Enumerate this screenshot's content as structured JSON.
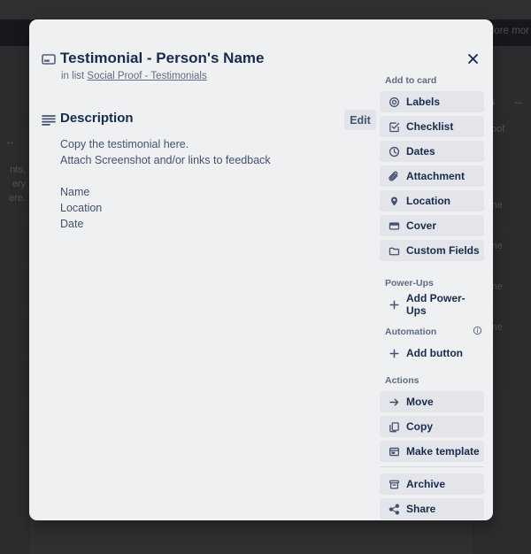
{
  "background": {
    "topbar_text": "xplore mor",
    "right_list": {
      "title": "ials",
      "menu_glyph": "↔",
      "label_text": "Proof",
      "cards": [
        "lame",
        "lame",
        "lame",
        "lame"
      ]
    },
    "left_list": {
      "menu_glyph": "↔",
      "card_lines": [
        "nts,",
        "ery",
        "ere."
      ]
    }
  },
  "modal": {
    "card_icon": "card-icon",
    "title": "Testimonial - Person's Name",
    "in_list_prefix": "in list ",
    "list_name": "Social Proof - Testimonials",
    "close_icon": "close-icon",
    "description": {
      "icon": "description-lines-icon",
      "heading": "Description",
      "edit_label": "Edit",
      "body": "Copy the testimonial here.\nAttach Screenshot and/or links to feedback\n\nName\nLocation\nDate"
    },
    "sidebar": {
      "add_to_card": {
        "heading": "Add to card",
        "items": [
          {
            "label": "Labels",
            "icon": "labels-icon"
          },
          {
            "label": "Checklist",
            "icon": "checklist-icon"
          },
          {
            "label": "Dates",
            "icon": "clock-icon"
          },
          {
            "label": "Attachment",
            "icon": "paperclip-icon"
          },
          {
            "label": "Location",
            "icon": "location-pin-icon"
          },
          {
            "label": "Cover",
            "icon": "cover-icon"
          },
          {
            "label": "Custom Fields",
            "icon": "folder-icon"
          }
        ]
      },
      "power_ups": {
        "heading": "Power-Ups",
        "items": [
          {
            "label": "Add Power-Ups",
            "icon": "plus-icon"
          }
        ]
      },
      "automation": {
        "heading": "Automation",
        "info_icon": "info-icon",
        "items": [
          {
            "label": "Add button",
            "icon": "plus-icon"
          }
        ]
      },
      "actions": {
        "heading": "Actions",
        "items": [
          {
            "label": "Move",
            "icon": "arrow-right-icon"
          },
          {
            "label": "Copy",
            "icon": "copy-icon"
          },
          {
            "label": "Make template",
            "icon": "template-icon"
          }
        ],
        "items_after_divider": [
          {
            "label": "Archive",
            "icon": "archive-icon"
          },
          {
            "label": "Share",
            "icon": "share-icon"
          }
        ]
      }
    }
  },
  "colors": {
    "modal_bg": "#eff0f2",
    "button_bg": "#e3e5ea",
    "text_dark": "#172b4d",
    "text_muted": "#5e6c84",
    "overlay": "#3a3a3a"
  }
}
